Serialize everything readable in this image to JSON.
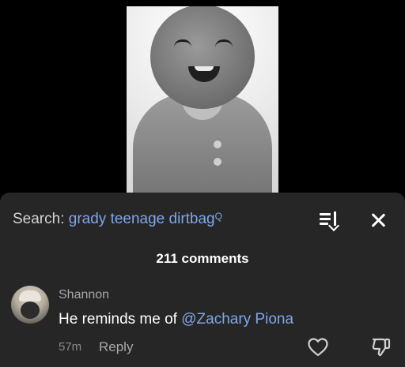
{
  "search": {
    "prefix": "Search: ",
    "term": "grady teenage dirtbag",
    "search_glyph": "Q"
  },
  "comments_count": "211 comments",
  "comment": {
    "author": "Shannon",
    "text_prefix": "He reminds me of ",
    "mention": "@Zachary Piona",
    "time": "57m",
    "reply_label": "Reply"
  },
  "icons": {
    "sort": "sort-icon",
    "close": "close-icon",
    "like": "heart-icon",
    "dislike": "thumbs-down-icon"
  },
  "colors": {
    "panel_bg": "#262626",
    "accent_link": "#7fa7ea"
  }
}
